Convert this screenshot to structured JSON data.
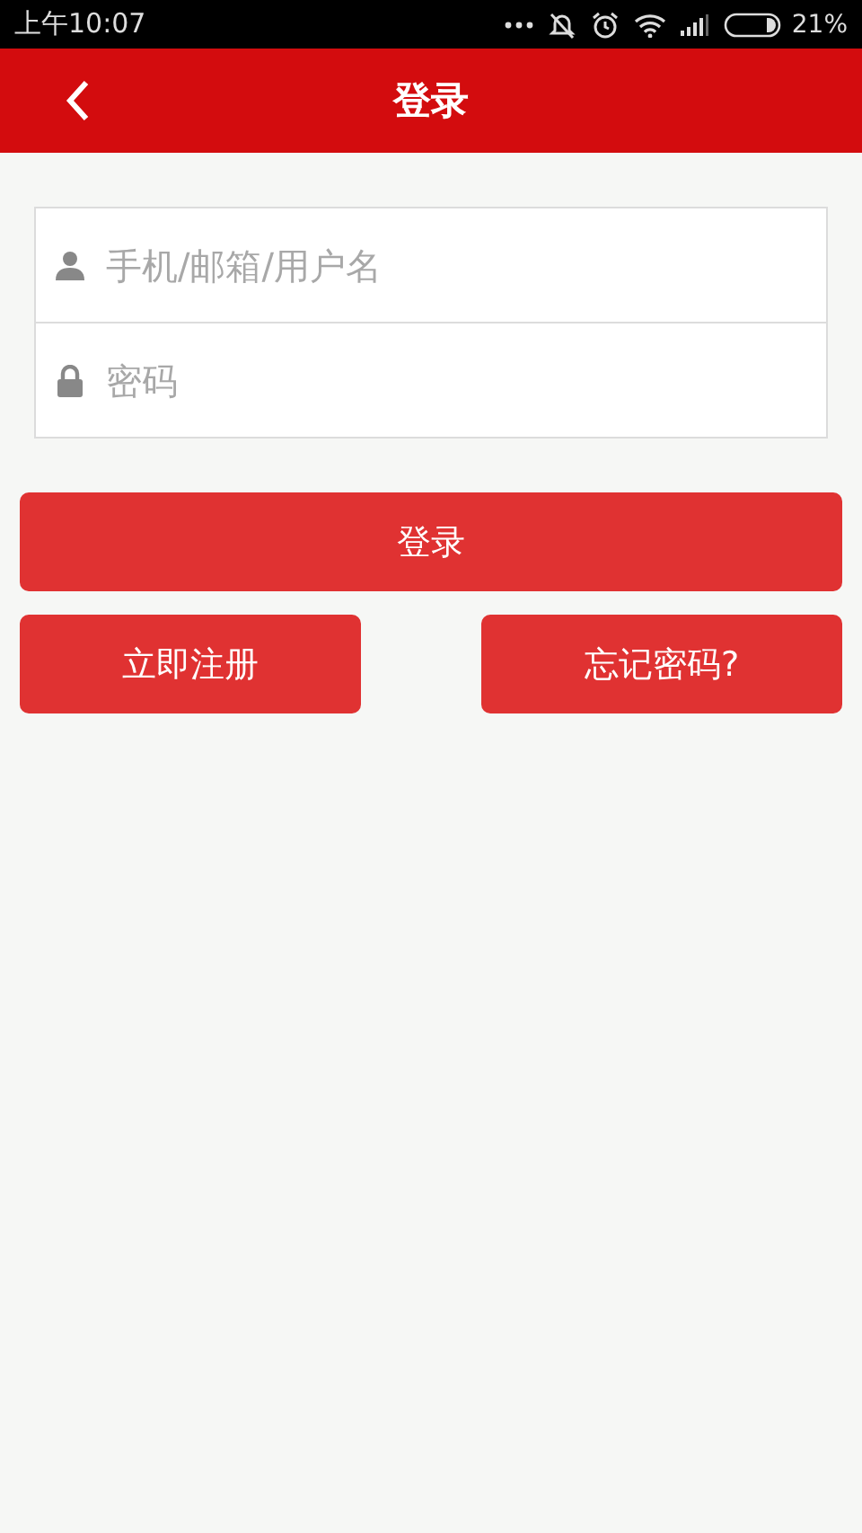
{
  "status_bar": {
    "time": "上午10:07",
    "battery": "21%"
  },
  "header": {
    "title": "登录"
  },
  "fields": [
    {
      "kind": "user",
      "placeholder": "手机/邮箱/用户名"
    },
    {
      "kind": "lock",
      "placeholder": "密码"
    }
  ],
  "login_button": "登录",
  "links": [
    "立即注册",
    "忘记密码?"
  ]
}
